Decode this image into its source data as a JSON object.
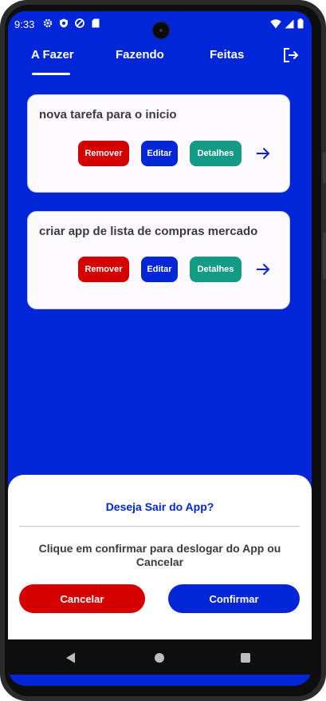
{
  "status_bar": {
    "time": "9:33",
    "left_icons": [
      "gear-icon",
      "shield-icon",
      "no-disturb-icon",
      "sd-card-icon"
    ],
    "right_icons": [
      "wifi-icon",
      "signal-icon",
      "battery-icon"
    ]
  },
  "tabs": [
    {
      "label": "A Fazer",
      "selected": true
    },
    {
      "label": "Fazendo",
      "selected": false
    },
    {
      "label": "Feitas",
      "selected": false
    }
  ],
  "header": {
    "logout_icon": "logout-icon"
  },
  "tasks": [
    {
      "title": "nova tarefa para o inicio",
      "remove_label": "Remover",
      "edit_label": "Editar",
      "details_label": "Detalhes",
      "move_icon": "arrow-right-icon"
    },
    {
      "title": "criar app de lista de compras mercado",
      "remove_label": "Remover",
      "edit_label": "Editar",
      "details_label": "Detalhes",
      "move_icon": "arrow-right-icon"
    }
  ],
  "dialog": {
    "title": "Deseja Sair do App?",
    "message": "Clique em confirmar para deslogar do App ou Cancelar",
    "cancel_label": "Cancelar",
    "confirm_label": "Confirmar"
  },
  "colors": {
    "primary": "#0026d8",
    "danger": "#d40000",
    "details": "#139b88",
    "card_bg": "#fdfaff",
    "text_dark": "#3b3b3b"
  },
  "nav": {
    "icons": [
      "back-icon",
      "home-icon",
      "recents-icon"
    ]
  }
}
